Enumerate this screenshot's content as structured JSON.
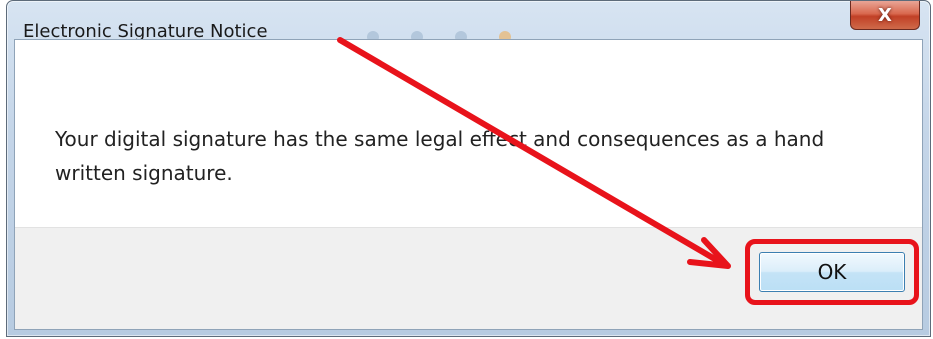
{
  "dialog": {
    "title": "Electronic Signature Notice",
    "close_label": "X",
    "message": "Your digital signature has the same legal effect and consequences as a hand written signature.",
    "ok_label": "OK"
  },
  "annotation": {
    "color": "#e8131b"
  }
}
